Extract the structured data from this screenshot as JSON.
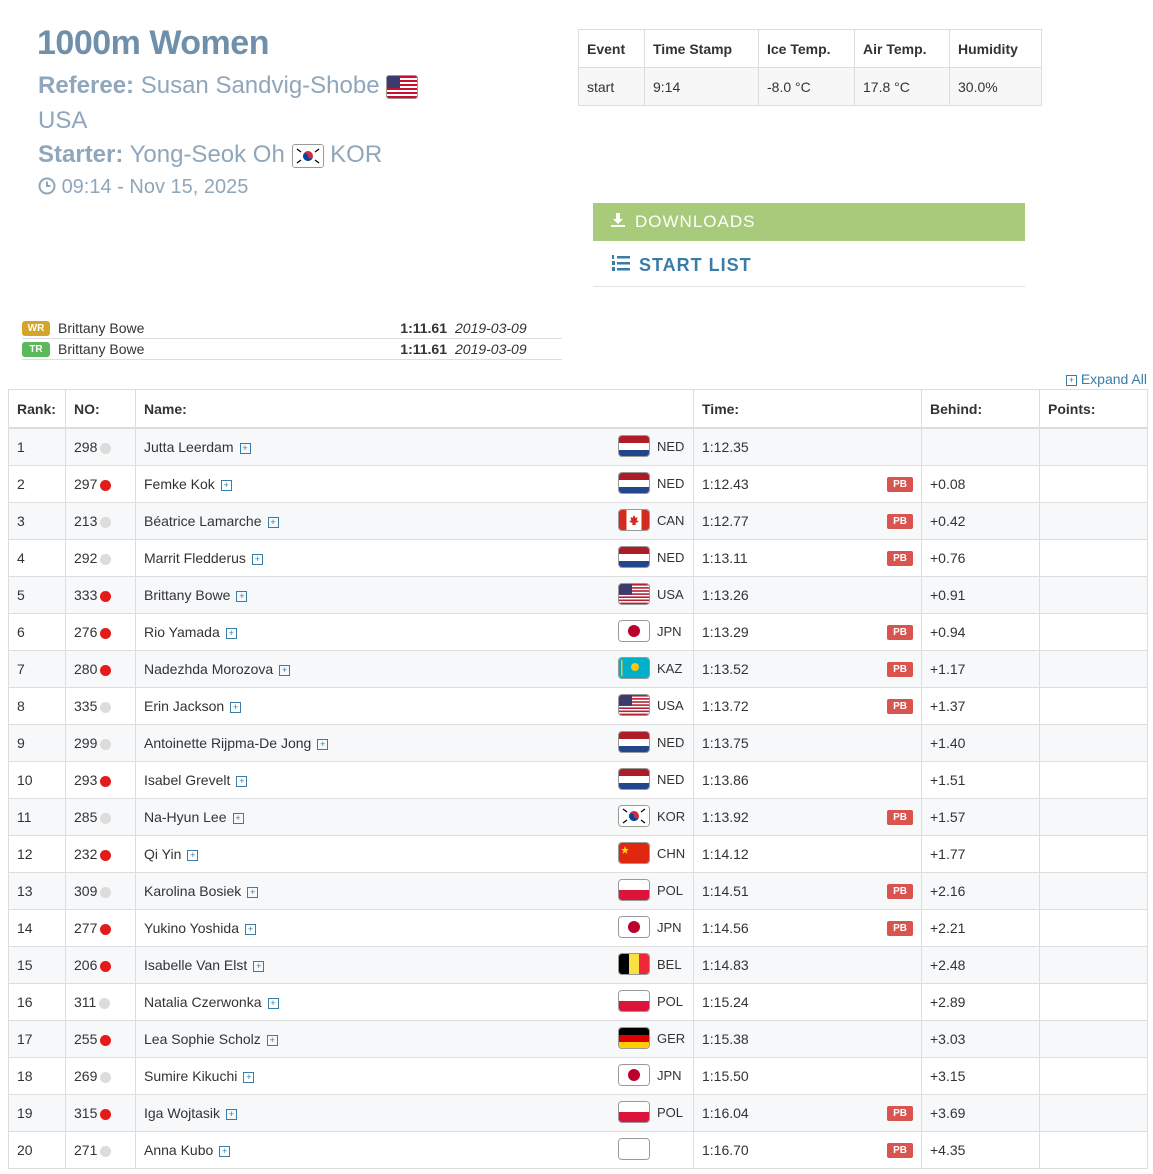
{
  "title": "1000m Women",
  "referee": {
    "label": "Referee:",
    "name": "Susan Sandvig-Shobe",
    "country": "USA",
    "flag": "usa"
  },
  "starter": {
    "label": "Starter:",
    "name": "Yong-Seok Oh",
    "country": "KOR",
    "flag": "kor"
  },
  "datetime": "09:14 - Nov 15, 2025",
  "conditions": {
    "headers": [
      "Event",
      "Time Stamp",
      "Ice Temp.",
      "Air Temp.",
      "Humidity"
    ],
    "values": [
      "start",
      "9:14",
      "-8.0 °C",
      "17.8 °C",
      "30.0%"
    ]
  },
  "downloads_label": "DOWNLOADS",
  "start_list_label": "START LIST",
  "records": [
    {
      "badge": "WR",
      "color": "#d5a52a",
      "name": "Brittany Bowe",
      "time": "1:11.61",
      "date": "2019-03-09"
    },
    {
      "badge": "TR",
      "color": "#5cb85c",
      "name": "Brittany Bowe",
      "time": "1:11.61",
      "date": "2019-03-09"
    }
  ],
  "expand_all_label": "Expand All",
  "columns": [
    "Rank:",
    "NO:",
    "Name:",
    "Time:",
    "Behind:",
    "Points:"
  ],
  "pb_label": "PB",
  "rows": [
    {
      "rank": "1",
      "no": "298",
      "dot": "grey",
      "name": "Jutta Leerdam",
      "nat": "NED",
      "time": "1:12.35",
      "pb": false,
      "behind": ""
    },
    {
      "rank": "2",
      "no": "297",
      "dot": "red",
      "name": "Femke Kok",
      "nat": "NED",
      "time": "1:12.43",
      "pb": true,
      "behind": "+0.08"
    },
    {
      "rank": "3",
      "no": "213",
      "dot": "grey",
      "name": "Béatrice Lamarche",
      "nat": "CAN",
      "time": "1:12.77",
      "pb": true,
      "behind": "+0.42"
    },
    {
      "rank": "4",
      "no": "292",
      "dot": "grey",
      "name": "Marrit Fledderus",
      "nat": "NED",
      "time": "1:13.11",
      "pb": true,
      "behind": "+0.76"
    },
    {
      "rank": "5",
      "no": "333",
      "dot": "red",
      "name": "Brittany Bowe",
      "nat": "USA",
      "time": "1:13.26",
      "pb": false,
      "behind": "+0.91"
    },
    {
      "rank": "6",
      "no": "276",
      "dot": "red",
      "name": "Rio Yamada",
      "nat": "JPN",
      "time": "1:13.29",
      "pb": true,
      "behind": "+0.94"
    },
    {
      "rank": "7",
      "no": "280",
      "dot": "red",
      "name": "Nadezhda Morozova",
      "nat": "KAZ",
      "time": "1:13.52",
      "pb": true,
      "behind": "+1.17"
    },
    {
      "rank": "8",
      "no": "335",
      "dot": "grey",
      "name": "Erin Jackson",
      "nat": "USA",
      "time": "1:13.72",
      "pb": true,
      "behind": "+1.37"
    },
    {
      "rank": "9",
      "no": "299",
      "dot": "grey",
      "name": "Antoinette Rijpma-De Jong",
      "nat": "NED",
      "time": "1:13.75",
      "pb": false,
      "behind": "+1.40"
    },
    {
      "rank": "10",
      "no": "293",
      "dot": "red",
      "name": "Isabel Grevelt",
      "nat": "NED",
      "time": "1:13.86",
      "pb": false,
      "behind": "+1.51"
    },
    {
      "rank": "11",
      "no": "285",
      "dot": "grey",
      "name": "Na-Hyun Lee",
      "nat": "KOR",
      "time": "1:13.92",
      "pb": true,
      "behind": "+1.57"
    },
    {
      "rank": "12",
      "no": "232",
      "dot": "red",
      "name": "Qi Yin",
      "nat": "CHN",
      "time": "1:14.12",
      "pb": false,
      "behind": "+1.77"
    },
    {
      "rank": "13",
      "no": "309",
      "dot": "grey",
      "name": "Karolina Bosiek",
      "nat": "POL",
      "time": "1:14.51",
      "pb": true,
      "behind": "+2.16"
    },
    {
      "rank": "14",
      "no": "277",
      "dot": "red",
      "name": "Yukino Yoshida",
      "nat": "JPN",
      "time": "1:14.56",
      "pb": true,
      "behind": "+2.21"
    },
    {
      "rank": "15",
      "no": "206",
      "dot": "red",
      "name": "Isabelle Van Elst",
      "nat": "BEL",
      "time": "1:14.83",
      "pb": false,
      "behind": "+2.48"
    },
    {
      "rank": "16",
      "no": "311",
      "dot": "grey",
      "name": "Natalia Czerwonka",
      "nat": "POL",
      "time": "1:15.24",
      "pb": false,
      "behind": "+2.89"
    },
    {
      "rank": "17",
      "no": "255",
      "dot": "red",
      "name": "Lea Sophie Scholz",
      "nat": "GER",
      "time": "1:15.38",
      "pb": false,
      "behind": "+3.03"
    },
    {
      "rank": "18",
      "no": "269",
      "dot": "grey",
      "name": "Sumire Kikuchi",
      "nat": "JPN",
      "time": "1:15.50",
      "pb": false,
      "behind": "+3.15"
    },
    {
      "rank": "19",
      "no": "315",
      "dot": "red",
      "name": "Iga Wojtasik",
      "nat": "POL",
      "time": "1:16.04",
      "pb": true,
      "behind": "+3.69"
    },
    {
      "rank": "20",
      "no": "271",
      "dot": "grey",
      "name": "Anna Kubo",
      "nat": "",
      "time": "1:16.70",
      "pb": true,
      "behind": "+4.35"
    }
  ],
  "colors": {
    "red_dot": "#e31b1b",
    "grey_dot": "#dcdcdc",
    "title": "#6f8faa",
    "link": "#3a7ca8",
    "downloads_bg": "#a8ca7b",
    "pb_bg": "#d9534f"
  }
}
